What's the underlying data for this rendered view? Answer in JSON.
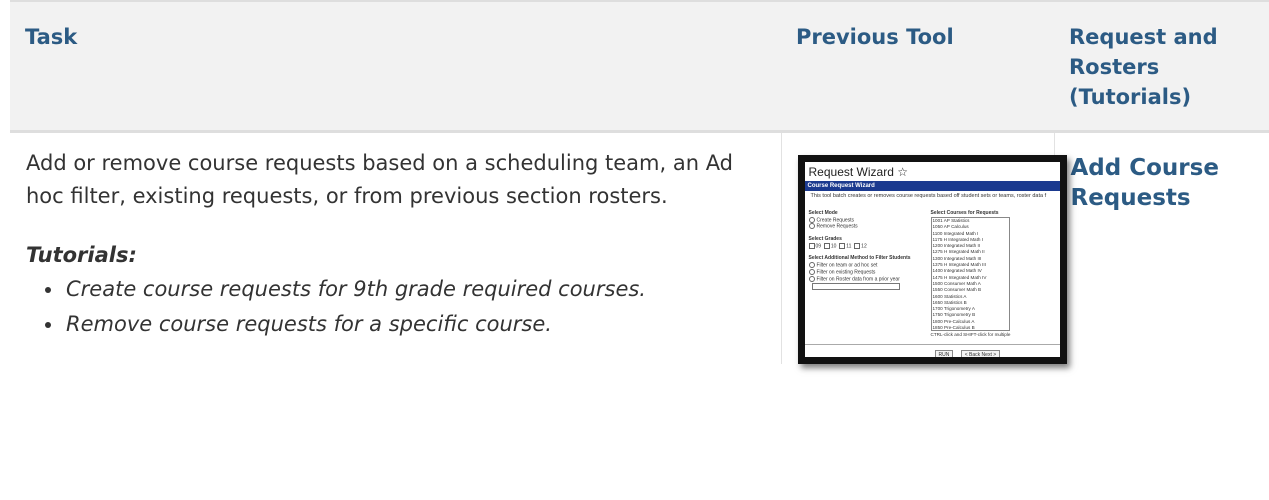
{
  "table": {
    "headers": [
      "Task",
      "Previous Tool",
      "Request and Rosters (Tutorials)"
    ],
    "row": {
      "task_description": "Add or remove course requests based on a scheduling team, an Ad hoc filter, existing requests, or from previous section rosters.",
      "tutorials_heading": "Tutorials:",
      "tutorials": [
        "Create course requests for 9th grade required courses.",
        "Remove course requests for a specific course."
      ],
      "link_label": "Add Course Requests"
    }
  },
  "thumbnail": {
    "window_title": "Request Wizard ☆",
    "bar_title": "Course Request Wizard",
    "description": "This tool batch creates or removes course requests based off student sets or teams, roster data f",
    "select_mode_label": "Select Mode",
    "mode_options": [
      "Create Requests",
      "Remove Requests"
    ],
    "select_grades_label": "Select Grades",
    "grades": [
      "09",
      "10",
      "11",
      "12"
    ],
    "filter_label": "Select Additional Method to Filter Students",
    "filter_options": [
      "Filter on team or ad hoc set",
      "Filter on existing Requests",
      "Filter on Roster data from a prior year"
    ],
    "courses_label": "Select Courses for Requests",
    "courses": [
      "1001 AP Statistics",
      "1050 AP Calculus",
      "1100 Integrated Math I",
      "1175 H Integrated Math I",
      "1200 Integrated Math II",
      "1275 H Integrated Math II",
      "1300 Integrated Math III",
      "1375 H Integrated Math III",
      "1400 Integrated Math IV",
      "1475 H Integrated Math IV",
      "1500 Consumer Math A",
      "1550 Consumer Math B",
      "1600 Statistics A",
      "1650 Statistics B",
      "1700 Trigonometry A",
      "1750 Trigonometry B",
      "1800 Pre-Calculus A",
      "1850 Pre-Calculus B"
    ],
    "multi_note": "CTRL-click and SHIFT-click for multiple",
    "run_label": "RUN",
    "nav_label": "< Back  Next >"
  }
}
